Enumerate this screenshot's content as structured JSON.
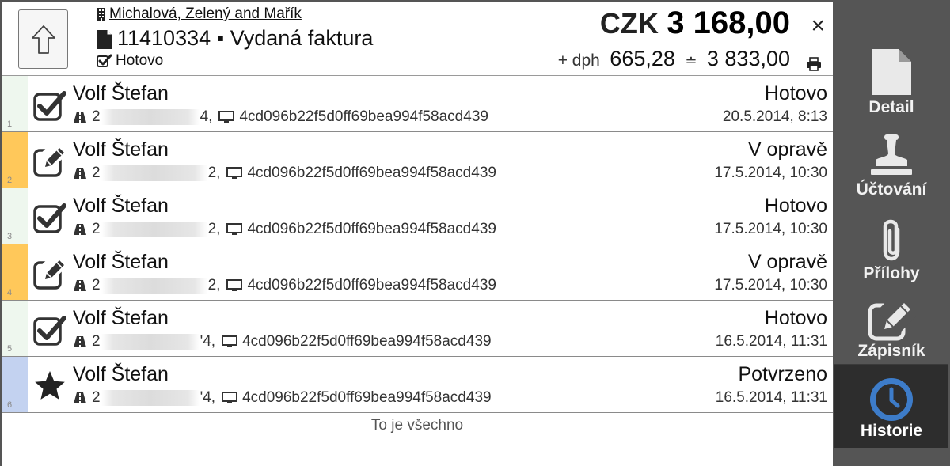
{
  "header": {
    "company": "Michalová, Zelený and Mařík",
    "document_number": "11410334",
    "document_separator": "▪",
    "document_type": "Vydaná faktura",
    "status": "Hotovo",
    "currency": "CZK",
    "amount": "3 168,00",
    "vat_label": "+ dph",
    "vat_amount": "665,28",
    "vat_separator": "≐",
    "total_amount": "3 833,00",
    "close_symbol": "×"
  },
  "rows": [
    {
      "index": "1",
      "name": "Volf Štefan",
      "id_start": "2",
      "id_end": "4,",
      "hash": "4cd096b22f5d0ff69bea994f58acd439",
      "status": "Hotovo",
      "timestamp": "20.5.2014, 8:13",
      "icon": "checkbox-checked-icon",
      "stripe_color": "#eef7ee"
    },
    {
      "index": "2",
      "name": "Volf Štefan",
      "id_start": "2",
      "id_end": "2,",
      "hash": "4cd096b22f5d0ff69bea994f58acd439",
      "status": "V opravě",
      "timestamp": "17.5.2014, 10:30",
      "icon": "edit-icon",
      "stripe_color": "#ffc85a"
    },
    {
      "index": "3",
      "name": "Volf Štefan",
      "id_start": "2",
      "id_end": "2,",
      "hash": "4cd096b22f5d0ff69bea994f58acd439",
      "status": "Hotovo",
      "timestamp": "17.5.2014, 10:30",
      "icon": "checkbox-checked-icon",
      "stripe_color": "#eef7ee"
    },
    {
      "index": "4",
      "name": "Volf Štefan",
      "id_start": "2",
      "id_end": "2,",
      "hash": "4cd096b22f5d0ff69bea994f58acd439",
      "status": "V opravě",
      "timestamp": "17.5.2014, 10:30",
      "icon": "edit-icon",
      "stripe_color": "#ffc85a"
    },
    {
      "index": "5",
      "name": "Volf Štefan",
      "id_start": "2",
      "id_end": "'4,",
      "hash": "4cd096b22f5d0ff69bea994f58acd439",
      "status": "Hotovo",
      "timestamp": "16.5.2014, 11:31",
      "icon": "checkbox-checked-icon",
      "stripe_color": "#eef7ee"
    },
    {
      "index": "6",
      "name": "Volf Štefan",
      "id_start": "2",
      "id_end": "'4,",
      "hash": "4cd096b22f5d0ff69bea994f58acd439",
      "status": "Potvrzeno",
      "timestamp": "16.5.2014, 11:31",
      "icon": "star-icon",
      "stripe_color": "#c3d2f0"
    }
  ],
  "footer": {
    "text": "To je všechno"
  },
  "sidebar": {
    "items": [
      {
        "label": "Detail",
        "icon": "document-icon"
      },
      {
        "label": "Účtování",
        "icon": "stamp-icon"
      },
      {
        "label": "Přílohy",
        "icon": "paperclip-icon"
      },
      {
        "label": "Zápisník",
        "icon": "notepad-edit-icon"
      },
      {
        "label": "Historie",
        "icon": "clock-icon",
        "active": true
      }
    ]
  },
  "colors": {
    "accent_blue": "#3d7cc9",
    "sidebar_bg": "#555555",
    "sidebar_active_bg": "#2d2d2d",
    "stripe_done": "#eef7ee",
    "stripe_repair": "#ffc85a",
    "stripe_confirmed": "#c3d2f0"
  }
}
